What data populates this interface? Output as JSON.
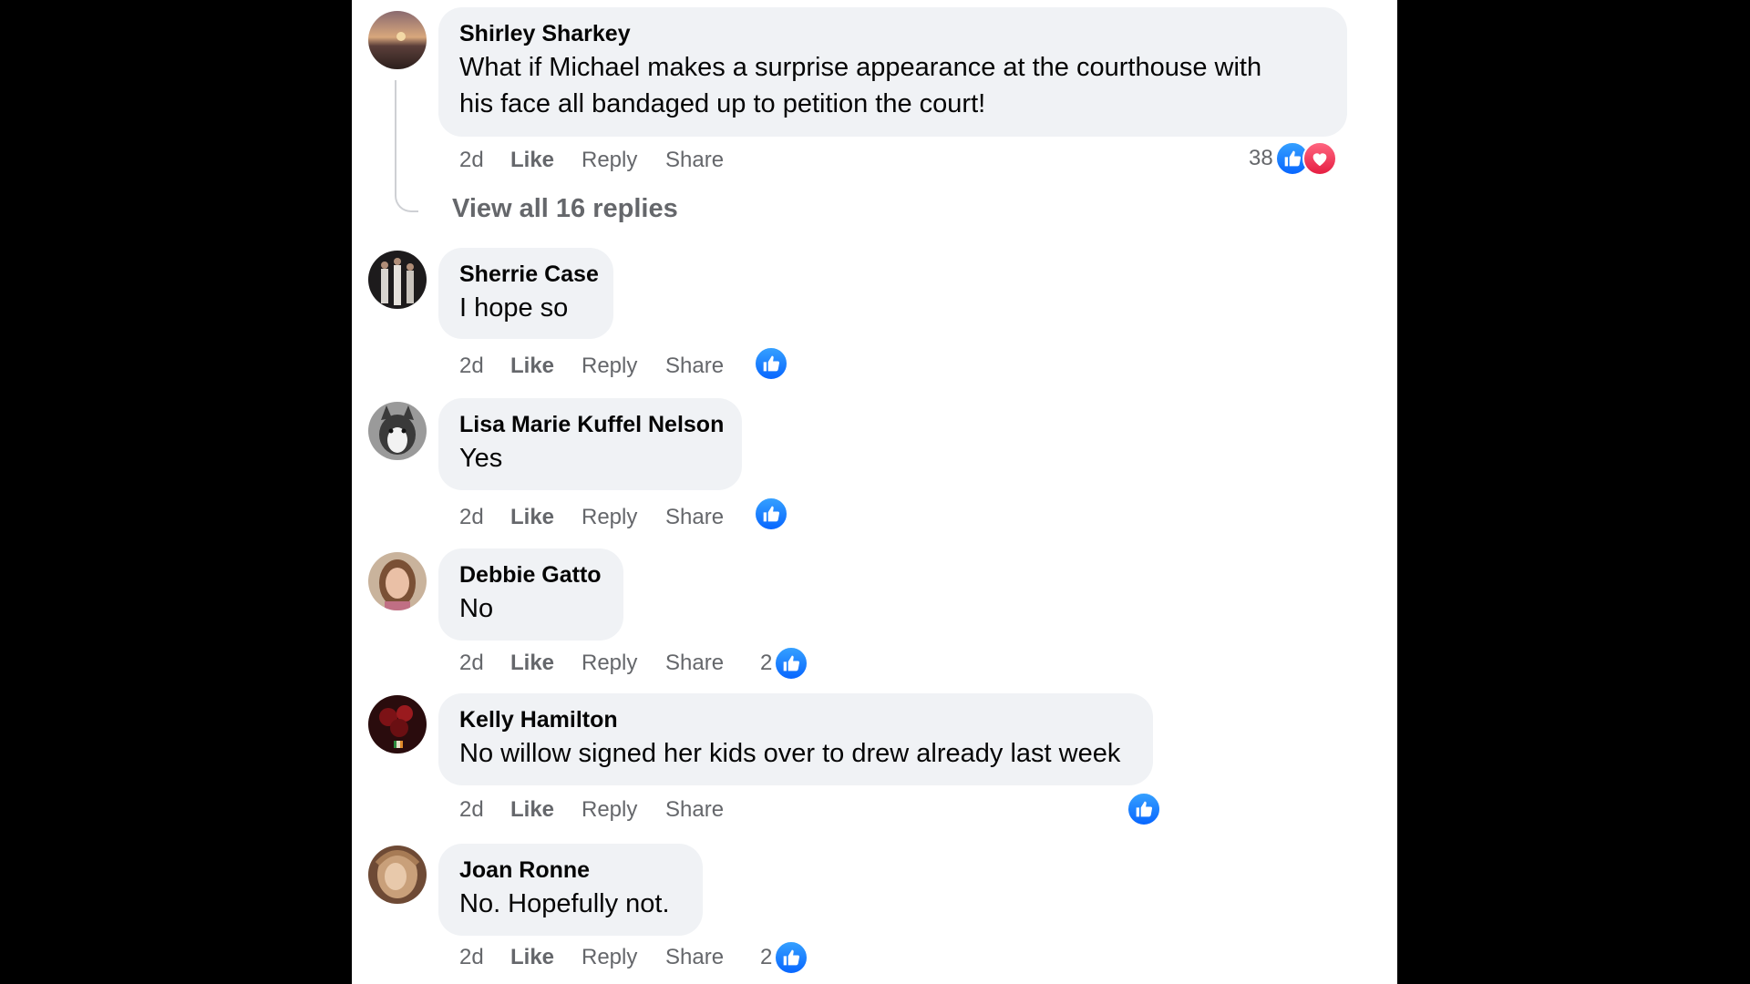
{
  "colors": {
    "background": "#000000",
    "panel": "#ffffff",
    "bubble": "#f0f2f5",
    "meta_text": "#65676b",
    "like_blue": "#0866ff",
    "love_red": "#e61e42"
  },
  "action_labels": {
    "like": "Like",
    "reply": "Reply",
    "share": "Share"
  },
  "view_replies": "View all 16 replies",
  "comments": [
    {
      "author": "Shirley Sharkey",
      "text_lines": [
        "What if Michael makes a surprise appearance at the courthouse with",
        "his face all bandaged up to petition the court!"
      ],
      "time": "2d",
      "reaction_count": "38",
      "reactions": [
        "like-icon",
        "love-icon"
      ],
      "avatar_icon": "sunset-avatar"
    },
    {
      "author": "Sherrie Case",
      "text_lines": [
        "I hope so"
      ],
      "time": "2d",
      "reaction_count": "",
      "reactions": [
        "like-icon"
      ],
      "avatar_icon": "group-photo-avatar"
    },
    {
      "author": "Lisa Marie Kuffel Nelson",
      "text_lines": [
        "Yes"
      ],
      "time": "2d",
      "reaction_count": "",
      "reactions": [
        "like-icon"
      ],
      "avatar_icon": "husky-dog-avatar"
    },
    {
      "author": "Debbie Gatto",
      "text_lines": [
        "No"
      ],
      "time": "2d",
      "reaction_count": "2",
      "reactions": [
        "like-icon"
      ],
      "avatar_icon": "woman-portrait-avatar"
    },
    {
      "author": "Kelly Hamilton",
      "text_lines": [
        "No willow signed her kids over to drew already last week"
      ],
      "time": "2d",
      "reaction_count": "",
      "reactions": [
        "like-icon"
      ],
      "avatar_icon": "roses-avatar"
    },
    {
      "author": "Joan Ronne",
      "text_lines": [
        "No. Hopefully not."
      ],
      "time": "2d",
      "reaction_count": "2",
      "reactions": [
        "like-icon"
      ],
      "avatar_icon": "portrait-avatar"
    }
  ]
}
